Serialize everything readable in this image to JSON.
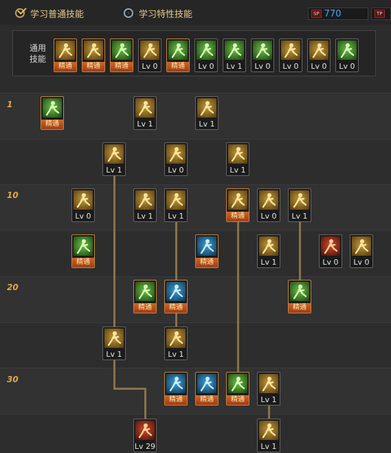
{
  "topbar": {
    "mode_normal": "学习普通技能",
    "mode_trait": "学习特性技能",
    "sp_tag": "SP",
    "sp_value": "770",
    "tp_tag": "TP",
    "tp_value": ""
  },
  "general_section": {
    "label": "通用技能",
    "skills": [
      {
        "icon": "sitting-figure-icon",
        "label": "精通",
        "mastered": true
      },
      {
        "icon": "flex-figure-icon",
        "label": "精通",
        "mastered": true
      },
      {
        "icon": "running-figure-icon",
        "label": "精通",
        "mastered": true
      },
      {
        "icon": "eagle-wings-icon",
        "label": "Lv 0",
        "mastered": false
      },
      {
        "icon": "crosshair-icon",
        "label": "精通",
        "mastered": true
      },
      {
        "icon": "target-gear-icon",
        "label": "Lv 0",
        "mastered": false
      },
      {
        "icon": "kneeling-figure-icon",
        "label": "Lv 1",
        "mastered": false
      },
      {
        "icon": "figure-gear-icon",
        "label": "Lv 0",
        "mastered": false
      },
      {
        "icon": "eye-orb-icon",
        "label": "Lv 0",
        "mastered": false
      },
      {
        "icon": "arms-raised-figure-icon",
        "label": "Lv 0",
        "mastered": false
      },
      {
        "icon": "jumping-figure-icon",
        "label": "Lv 0",
        "mastered": false
      }
    ]
  },
  "level_markers": [
    "1",
    "10",
    "20",
    "30"
  ],
  "tree_skills": [
    {
      "icon": "green-swirl-icon",
      "label": "精通",
      "mastered": true
    },
    {
      "icon": "dashing-boot-icon",
      "label": "Lv 1",
      "mastered": false
    },
    {
      "icon": "sword-slash-icon",
      "label": "Lv 1",
      "mastered": false
    },
    {
      "icon": "spinning-kick-icon",
      "label": "Lv 1",
      "mastered": false
    },
    {
      "icon": "guard-stance-icon",
      "label": "Lv 0",
      "mastered": false
    },
    {
      "icon": "explosion-strike-icon",
      "label": "Lv 1",
      "mastered": false
    },
    {
      "icon": "cross-blades-icon",
      "label": "Lv 0",
      "mastered": false
    },
    {
      "icon": "burning-figure-icon",
      "label": "Lv 1",
      "mastered": false
    },
    {
      "icon": "muscle-figure-icon",
      "label": "Lv 1",
      "mastered": false
    },
    {
      "icon": "sprinting-figure-icon",
      "label": "精通",
      "mastered": true
    },
    {
      "icon": "crouch-strike-icon",
      "label": "Lv 0",
      "mastered": false
    },
    {
      "icon": "wind-dash-icon",
      "label": "Lv 1",
      "mastered": false
    },
    {
      "icon": "green-fist-icon",
      "label": "精通",
      "mastered": true
    },
    {
      "icon": "blue-slash-icon",
      "label": "精通",
      "mastered": true
    },
    {
      "icon": "flying-kick-icon",
      "label": "Lv 1",
      "mastered": false
    },
    {
      "icon": "fire-punch-icon",
      "label": "Lv 0",
      "mastered": false
    },
    {
      "icon": "crescent-kick-icon",
      "label": "Lv 0",
      "mastered": false
    },
    {
      "icon": "green-burst-icon",
      "label": "精通",
      "mastered": true
    },
    {
      "icon": "blue-aura-figure-icon",
      "label": "精通",
      "mastered": true
    },
    {
      "icon": "green-whirl-figure-icon",
      "label": "精通",
      "mastered": true
    },
    {
      "icon": "backflip-kick-icon",
      "label": "Lv 1",
      "mastered": false
    },
    {
      "icon": "rising-uppercut-icon",
      "label": "Lv 1",
      "mastered": false
    },
    {
      "icon": "blue-star-burst-icon",
      "label": "精通",
      "mastered": true
    },
    {
      "icon": "blue-power-figure-icon",
      "label": "精通",
      "mastered": true
    },
    {
      "icon": "green-runner-icon",
      "label": "精通",
      "mastered": true
    },
    {
      "icon": "sliding-kick-icon",
      "label": "Lv 1",
      "mastered": false
    },
    {
      "icon": "red-awakening-icon",
      "label": "Lv 29",
      "mastered": false
    },
    {
      "icon": "ground-slam-icon",
      "label": "Lv 1",
      "mastered": false
    }
  ],
  "colors": {
    "level_marker": "#e2a845",
    "sp_value": "#3fa9ff",
    "mastery_badge": "#ce6628",
    "connector": "#8b7246"
  }
}
